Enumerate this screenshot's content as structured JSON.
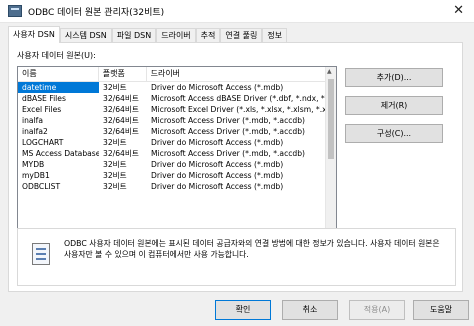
{
  "window": {
    "title": "ODBC 데이터 원본 관리자(32비트)",
    "close_label": "✕"
  },
  "tabs": [
    {
      "label": "사용자 DSN",
      "active": true
    },
    {
      "label": "시스템 DSN"
    },
    {
      "label": "파일 DSN"
    },
    {
      "label": "드라이버"
    },
    {
      "label": "추적"
    },
    {
      "label": "연결 풀링"
    },
    {
      "label": "정보"
    }
  ],
  "panel": {
    "group_label": "사용자 데이터 원본(U):",
    "columns": [
      "이름",
      "플랫폼",
      "드라이버"
    ],
    "rows": [
      {
        "name": "datetime",
        "platform": "32비트",
        "driver": "Driver do Microsoft Access (*.mdb)"
      },
      {
        "name": "dBASE Files",
        "platform": "32/64비트",
        "driver": "Microsoft Access dBASE Driver (*.dbf, *.ndx, *.mdx)"
      },
      {
        "name": "Excel Files",
        "platform": "32/64비트",
        "driver": "Microsoft Excel Driver (*.xls, *.xlsx, *.xlsm, *.xlsb)"
      },
      {
        "name": "inalfa",
        "platform": "32/64비트",
        "driver": "Microsoft Access Driver (*.mdb, *.accdb)"
      },
      {
        "name": "inalfa2",
        "platform": "32/64비트",
        "driver": "Microsoft Access Driver (*.mdb, *.accdb)"
      },
      {
        "name": "LOGCHART",
        "platform": "32비트",
        "driver": "Driver do Microsoft Access (*.mdb)"
      },
      {
        "name": "MS Access Database",
        "platform": "32/64비트",
        "driver": "Microsoft Access Driver (*.mdb, *.accdb)"
      },
      {
        "name": "MYDB",
        "platform": "32비트",
        "driver": "Driver do Microsoft Access (*.mdb)"
      },
      {
        "name": "myDB1",
        "platform": "32비트",
        "driver": "Driver do Microsoft Access (*.mdb)"
      },
      {
        "name": "ODBCLIST",
        "platform": "32비트",
        "driver": "Driver do Microsoft Access (*.mdb)"
      }
    ],
    "buttons": {
      "add": "추가(D)...",
      "remove": "제거(R)",
      "configure": "구성(C)..."
    },
    "info_text": "ODBC 사용자 데이터 원본에는 표시된 데이터 공급자와의 연결 방법에 대한 정보가 있습니다. 사용자 데이터 원본은 사용자만 볼 수 있으며 이 컴퓨터에서만 사용 가능합니다."
  },
  "footer": {
    "ok": "확인",
    "cancel": "취소",
    "apply": "적용(A)",
    "help": "도움말"
  }
}
